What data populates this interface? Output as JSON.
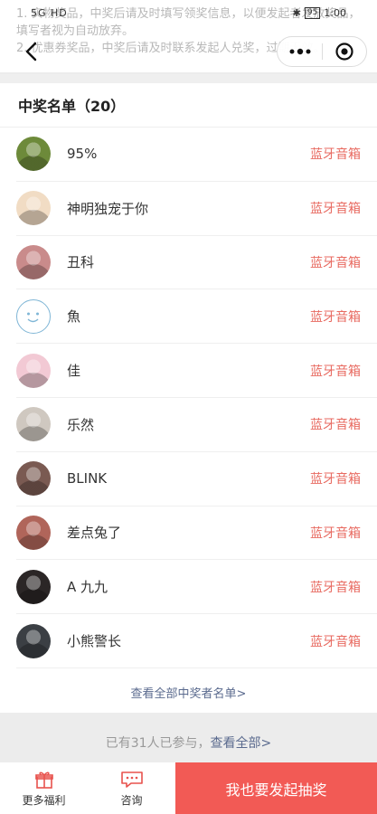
{
  "background_notice": {
    "line1": "1. 实物奖品，中奖后请及时填写领奖信息，以便发起者发放奖品，未",
    "line2": "填写者视为自动放弃。",
    "line3": "2. 优惠券奖品，中奖后请及时联系发起人兑奖，过期无效。"
  },
  "status_bar": {
    "time": "1:00",
    "battery": "95",
    "carrier": "5G HD"
  },
  "winners": {
    "title": "中奖名单（20）",
    "items": [
      {
        "name": "95%",
        "prize": "蓝牙音箱",
        "avatar_color": "#6d8a3a"
      },
      {
        "name": "神明独宠于你",
        "prize": "蓝牙音箱",
        "avatar_color": "#f1dcc4"
      },
      {
        "name": "丑科",
        "prize": "蓝牙音箱",
        "avatar_color": "#c98b8b"
      },
      {
        "name": "魚",
        "prize": "蓝牙音箱",
        "avatar_color": "#ffffff"
      },
      {
        "name": "佳",
        "prize": "蓝牙音箱",
        "avatar_color": "#f2c9d4"
      },
      {
        "name": "乐然",
        "prize": "蓝牙音箱",
        "avatar_color": "#cfc8c0"
      },
      {
        "name": "BLINK",
        "prize": "蓝牙音箱",
        "avatar_color": "#7a5a52"
      },
      {
        "name": "差点兔了",
        "prize": "蓝牙音箱",
        "avatar_color": "#b0655a"
      },
      {
        "name": "A 九九",
        "prize": "蓝牙音箱",
        "avatar_color": "#2b2626"
      },
      {
        "name": "小熊警长",
        "prize": "蓝牙音箱",
        "avatar_color": "#3b3f44"
      }
    ],
    "view_all": "查看全部中奖者名单>"
  },
  "participants": {
    "text": "已有31人已参与，",
    "link": "查看全部>"
  },
  "bottom_bar": {
    "more_benefits": "更多福利",
    "consult": "咨询",
    "launch": "我也要发起抽奖"
  },
  "colors": {
    "accent": "#f25a55",
    "prize_text": "#e86a60",
    "link": "#5a6a8e"
  }
}
